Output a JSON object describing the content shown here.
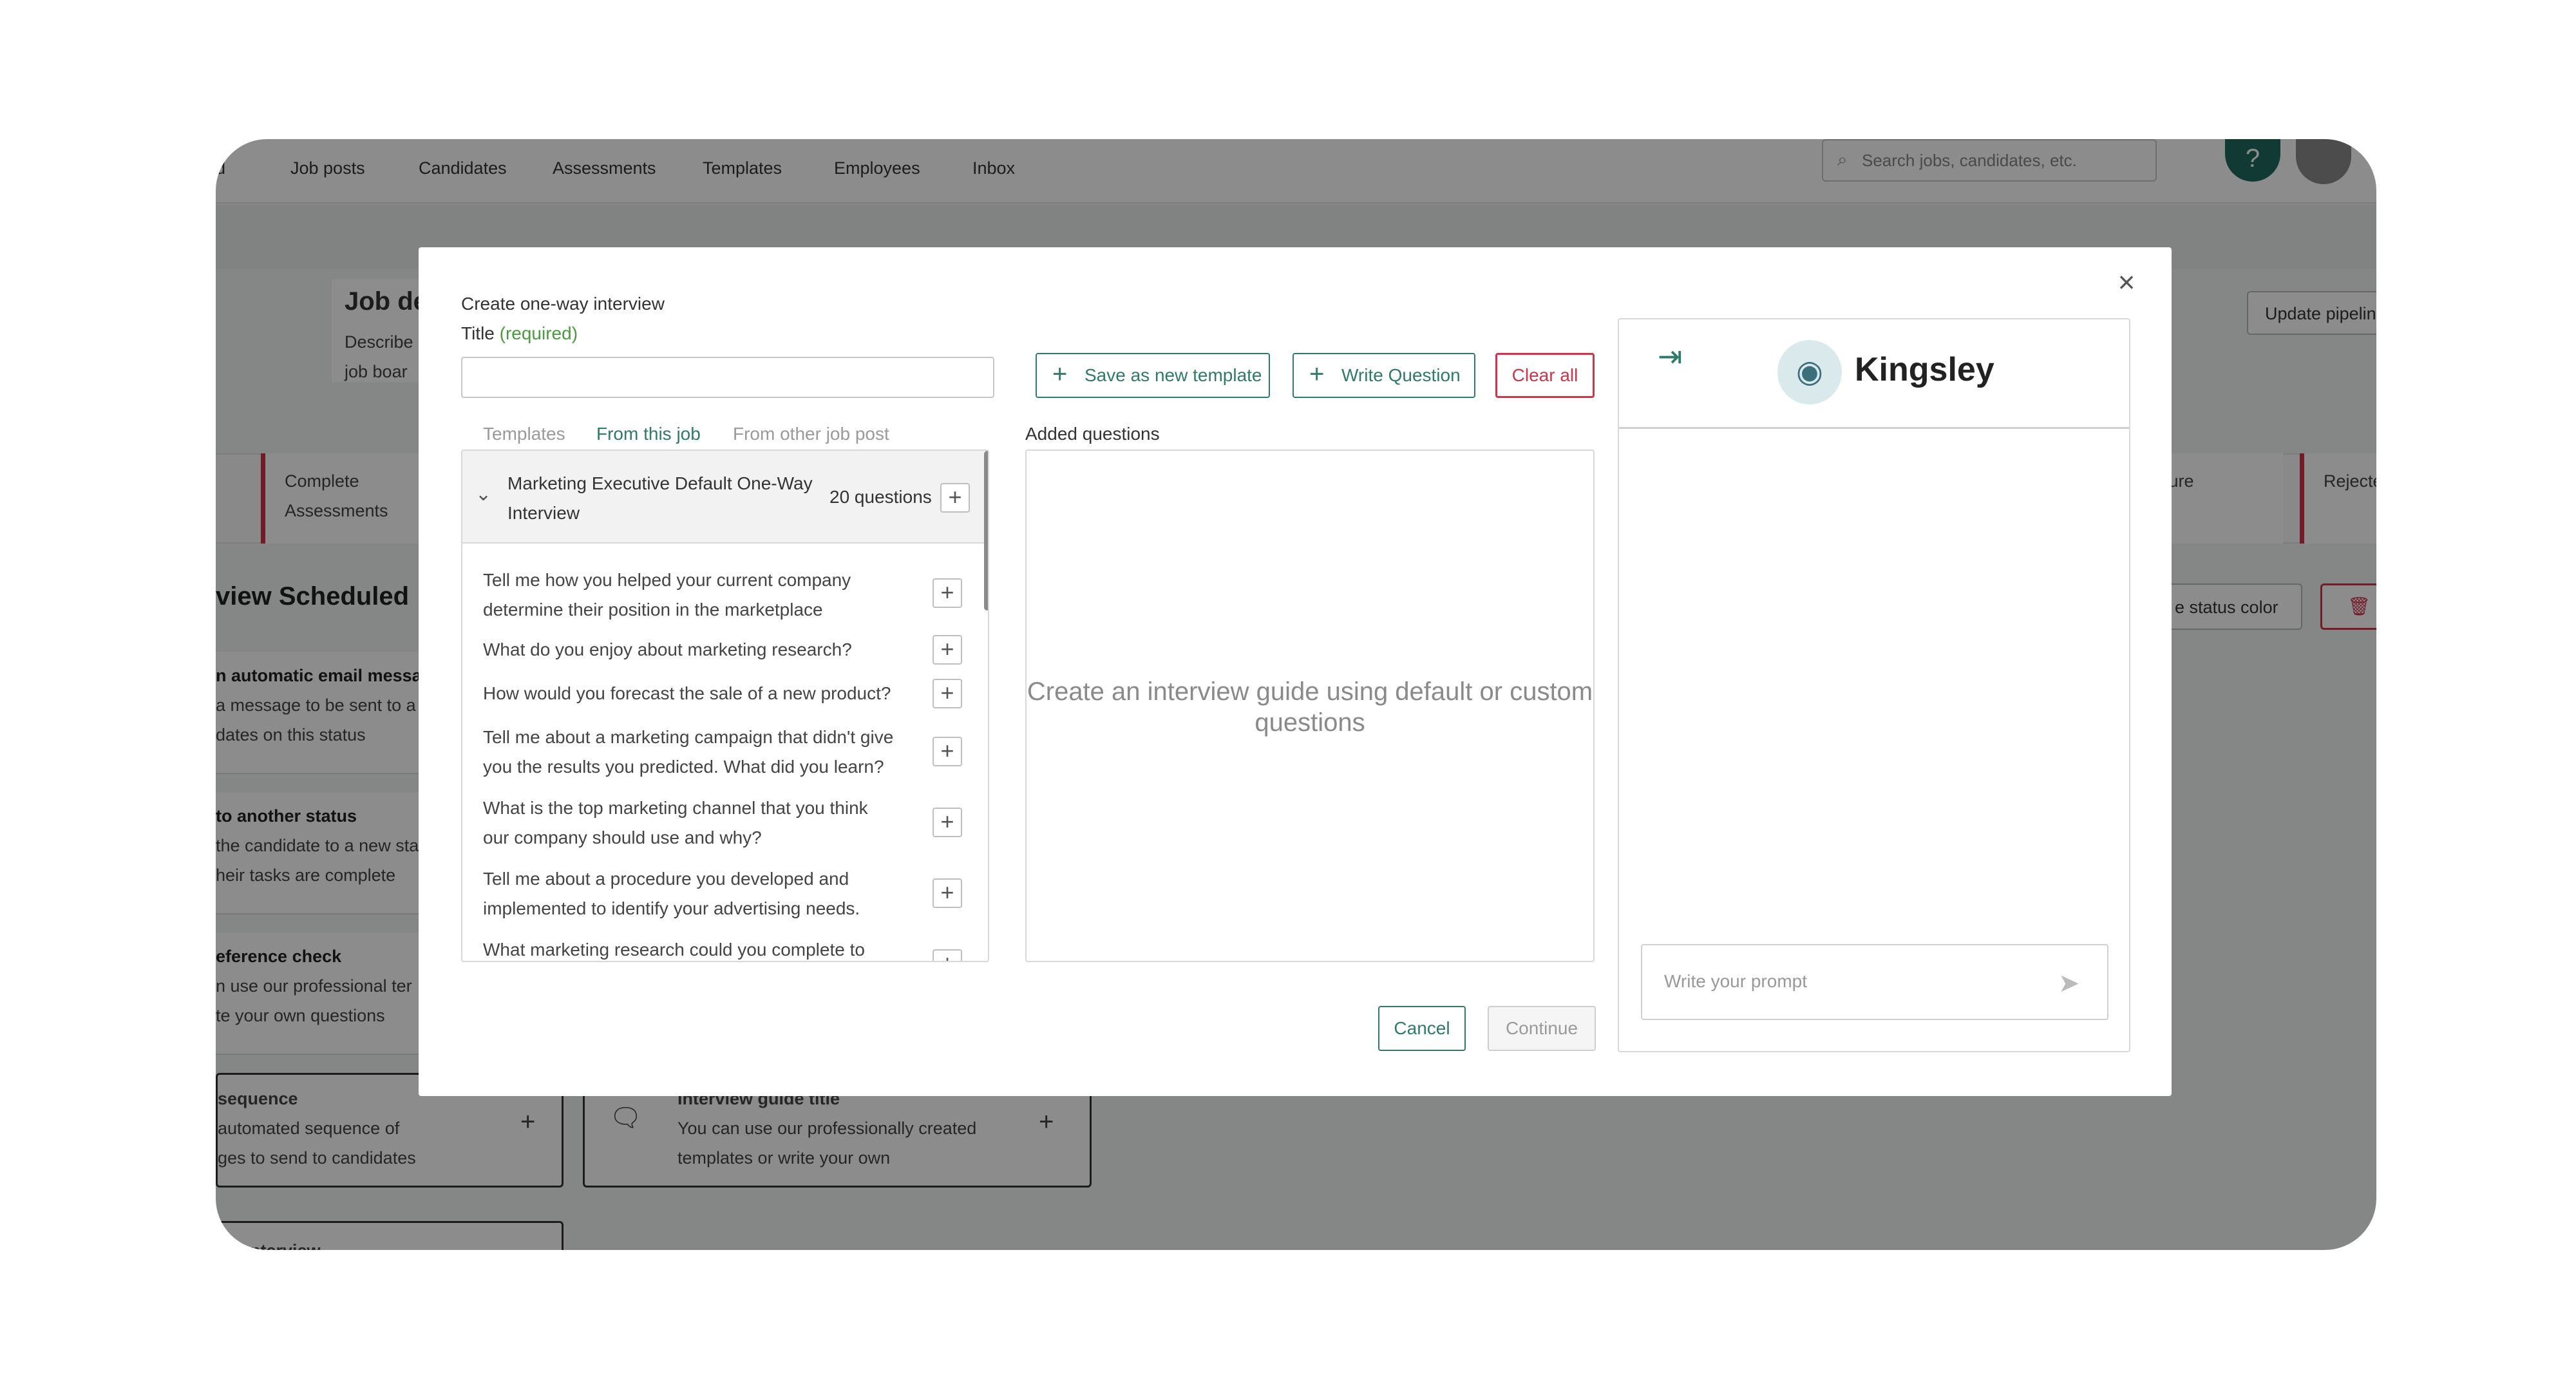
{
  "topnav": {
    "items": [
      "d",
      "Job posts",
      "Candidates",
      "Assessments",
      "Templates",
      "Employees",
      "Inbox"
    ],
    "search_placeholder": "Search jobs, candidates, etc.",
    "help_label": "?",
    "search_icon": "search-icon",
    "avatar_icon": "user-avatar-icon"
  },
  "background": {
    "job_title": "Job de",
    "job_desc_1": "Describe",
    "job_desc_2": "job boar",
    "update_button": "Update pipelin",
    "stage_1_line1": "Complete",
    "stage_1_line2": "Assessments",
    "stage_2_line1": "uture",
    "stage_2_line2": "...",
    "stage_3": "Rejecte",
    "section_title": "view Scheduled",
    "status_color_btn": "e status color",
    "cards": [
      {
        "title": "n automatic email messa",
        "line1": "a message to be sent to a",
        "line2": "dates on this status"
      },
      {
        "title": "to another status",
        "line1": "the candidate to a new sta",
        "line2": "heir tasks are complete"
      },
      {
        "title": "eference check",
        "line1": "n use our professional ter",
        "line2": "te your own questions"
      },
      {
        "title": "sequence",
        "line1": "automated sequence of",
        "line2": "ges to send to candidates"
      }
    ],
    "guide_card": {
      "title": "Interview guide title",
      "line1": "You can use our professionally created",
      "line2": "templates or write your own"
    },
    "bottom_card": "nterview"
  },
  "modal": {
    "heading": "Create one-way interview",
    "title_label": "Title",
    "title_required": "(required)",
    "title_value": "",
    "save_template_label": "Save as new template",
    "write_question_label": "Write Question",
    "clear_all_label": "Clear all",
    "tabs": [
      {
        "label": "Templates",
        "active": false
      },
      {
        "label": "From this job",
        "active": true
      },
      {
        "label": "From other job post",
        "active": false
      }
    ],
    "added_questions_label": "Added questions",
    "group": {
      "title": "Marketing Executive Default One-Way Interview",
      "count": "20 questions"
    },
    "questions": [
      "Tell me how you helped your current company determine their position in the marketplace",
      "What do you enjoy about marketing research?",
      "How would you forecast the sale of a new product?",
      "Tell me about a marketing campaign that didn't give you the results you predicted. What did you learn?",
      "What is the top marketing channel that you think our company should use and why?",
      "Tell me about a procedure you developed and implemented to identify your advertising needs.",
      "What marketing research could you complete to help"
    ],
    "empty_state": "Create an interview guide using default or custom questions",
    "cancel_label": "Cancel",
    "continue_label": "Continue"
  },
  "assistant": {
    "name": "Kingsley",
    "prompt_placeholder": "Write your prompt"
  },
  "colors": {
    "accent": "#2f7a6a",
    "danger": "#d0344a",
    "required": "#4a9a3e"
  }
}
